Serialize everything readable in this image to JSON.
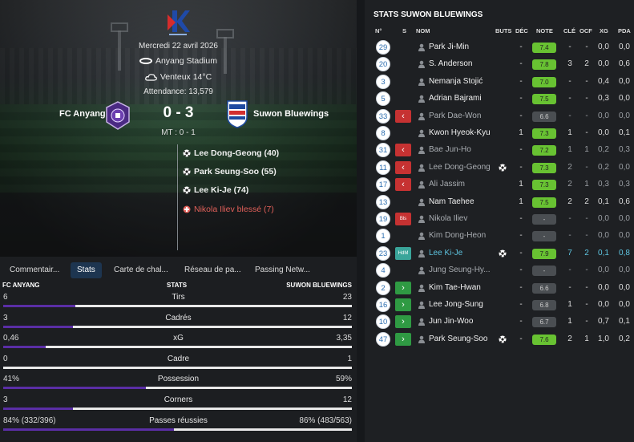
{
  "match": {
    "date": "Mercredi 22 avril 2026",
    "stadium": "Anyang Stadium",
    "weather": "Venteux 14°C",
    "attendance": "Attendance: 13,579",
    "home_team": "FC Anyang",
    "away_team": "Suwon Bluewings",
    "score": "0 - 3",
    "halftime": "MT : 0 - 1",
    "events": [
      {
        "text": "Lee Dong-Geong (40)",
        "type": "goal"
      },
      {
        "text": "Park Seung-Soo (55)",
        "type": "goal"
      },
      {
        "text": "Lee Ki-Je (74)",
        "type": "goal"
      },
      {
        "text": "Nikola Iliev blessé (7)",
        "type": "injury"
      }
    ],
    "colors": {
      "injury": "#e2605a",
      "home": "#5a2ea6",
      "accent_tab": "#1d3550"
    }
  },
  "tabs": [
    {
      "label": "Commentair..."
    },
    {
      "label": "Stats",
      "active": true
    },
    {
      "label": "Carte de chal..."
    },
    {
      "label": "Réseau de pa..."
    },
    {
      "label": "Passing Netw..."
    }
  ],
  "stats": {
    "home_header": "FC ANYANG",
    "center_header": "STATS",
    "away_header": "SUWON BLUEWINGS",
    "rows": [
      {
        "label": "Tirs",
        "home": "6",
        "away": "23",
        "home_share": 0.207
      },
      {
        "label": "Cadrés",
        "home": "3",
        "away": "12",
        "home_share": 0.2
      },
      {
        "label": "xG",
        "home": "0,46",
        "away": "3,35",
        "home_share": 0.121
      },
      {
        "label": "Cadre",
        "home": "0",
        "away": "1",
        "home_share": 0.0
      },
      {
        "label": "Possession",
        "home": "41%",
        "away": "59%",
        "home_share": 0.41
      },
      {
        "label": "Corners",
        "home": "3",
        "away": "12",
        "home_share": 0.2
      },
      {
        "label": "Passes réussies",
        "home": "84% (332/396)",
        "away": "86% (483/563)",
        "home_share": 0.49
      }
    ]
  },
  "player_stats": {
    "title": "STATS SUWON BLUEWINGS",
    "headers": {
      "num": "N°",
      "s": "S",
      "name": "NOM",
      "goals": "BUTS",
      "dec": "DÉC",
      "note": "NOTE",
      "key": "CLÉ",
      "ocf": "OCF",
      "xg": "XG",
      "pda": "PDA"
    },
    "players": [
      {
        "num": "29",
        "sub": "",
        "name": "Park Ji-Min",
        "goal": false,
        "dec": "-",
        "note": "7.4",
        "key": "-",
        "ocf": "-",
        "xg": "0,0",
        "pda": "0,0",
        "style": "normal"
      },
      {
        "num": "20",
        "sub": "",
        "name": "S. Anderson",
        "goal": false,
        "dec": "-",
        "note": "7.8",
        "key": "3",
        "ocf": "2",
        "xg": "0,0",
        "pda": "0,6",
        "style": "normal"
      },
      {
        "num": "3",
        "sub": "",
        "name": "Nemanja Stojić",
        "goal": false,
        "dec": "-",
        "note": "7.0",
        "key": "-",
        "ocf": "-",
        "xg": "0,4",
        "pda": "0,0",
        "style": "normal"
      },
      {
        "num": "5",
        "sub": "",
        "name": "Adrian Bajrami",
        "goal": false,
        "dec": "-",
        "note": "7.5",
        "key": "-",
        "ocf": "-",
        "xg": "0,3",
        "pda": "0,0",
        "style": "normal"
      },
      {
        "num": "33",
        "sub": "out",
        "name": "Park Dae-Won",
        "goal": false,
        "dec": "-",
        "note": "6.6",
        "key": "-",
        "ocf": "-",
        "xg": "0,0",
        "pda": "0,0",
        "style": "sub"
      },
      {
        "num": "8",
        "sub": "",
        "name": "Kwon Hyeok-Kyu",
        "goal": false,
        "dec": "1",
        "note": "7.3",
        "key": "1",
        "ocf": "-",
        "xg": "0,0",
        "pda": "0,1",
        "style": "normal"
      },
      {
        "num": "31",
        "sub": "out",
        "name": "Bae Jun-Ho",
        "goal": false,
        "dec": "-",
        "note": "7.2",
        "key": "1",
        "ocf": "1",
        "xg": "0,2",
        "pda": "0,3",
        "style": "sub"
      },
      {
        "num": "11",
        "sub": "out",
        "name": "Lee Dong-Geong",
        "goal": true,
        "dec": "-",
        "note": "7.3",
        "key": "2",
        "ocf": "-",
        "xg": "0,2",
        "pda": "0,0",
        "style": "sub"
      },
      {
        "num": "17",
        "sub": "out",
        "name": "Ali Jassim",
        "goal": false,
        "dec": "1",
        "note": "7.3",
        "key": "2",
        "ocf": "1",
        "xg": "0,3",
        "pda": "0,3",
        "style": "sub"
      },
      {
        "num": "13",
        "sub": "",
        "name": "Nam Taehee",
        "goal": false,
        "dec": "1",
        "note": "7.5",
        "key": "2",
        "ocf": "2",
        "xg": "0,1",
        "pda": "0,6",
        "style": "normal"
      },
      {
        "num": "19",
        "sub": "inj",
        "sub_label": "Bls",
        "name": "Nikola Iliev",
        "goal": false,
        "dec": "-",
        "note": "-",
        "key": "-",
        "ocf": "-",
        "xg": "0,0",
        "pda": "0,0",
        "style": "sub"
      },
      {
        "num": "1",
        "sub": "",
        "name": "Kim Dong-Heon",
        "goal": false,
        "dec": "-",
        "note": "-",
        "key": "-",
        "ocf": "-",
        "xg": "0,0",
        "pda": "0,0",
        "style": "sub"
      },
      {
        "num": "23",
        "sub": "hdm",
        "sub_label": "HdM",
        "name": "Lee Ki-Je",
        "goal": true,
        "dec": "-",
        "note": "7.9",
        "key": "7",
        "ocf": "2",
        "xg": "0,1",
        "pda": "0,8",
        "style": "hl"
      },
      {
        "num": "4",
        "sub": "",
        "name": "Jung Seung-Hy...",
        "goal": false,
        "dec": "-",
        "note": "-",
        "key": "-",
        "ocf": "-",
        "xg": "0,0",
        "pda": "0,0",
        "style": "sub"
      },
      {
        "num": "2",
        "sub": "in",
        "name": "Kim Tae-Hwan",
        "goal": false,
        "dec": "-",
        "note": "6.6",
        "key": "-",
        "ocf": "-",
        "xg": "0,0",
        "pda": "0,0",
        "style": "normal"
      },
      {
        "num": "16",
        "sub": "in",
        "name": "Lee Jong-Sung",
        "goal": false,
        "dec": "-",
        "note": "6.8",
        "key": "1",
        "ocf": "-",
        "xg": "0,0",
        "pda": "0,0",
        "style": "normal"
      },
      {
        "num": "10",
        "sub": "in",
        "name": "Jun Jin-Woo",
        "goal": false,
        "dec": "-",
        "note": "6.7",
        "key": "1",
        "ocf": "-",
        "xg": "0,7",
        "pda": "0,1",
        "style": "normal"
      },
      {
        "num": "47",
        "sub": "in",
        "name": "Park Seung-Soo",
        "goal": true,
        "dec": "-",
        "note": "7.6",
        "key": "2",
        "ocf": "1",
        "xg": "1,0",
        "pda": "0,2",
        "style": "normal"
      }
    ]
  }
}
